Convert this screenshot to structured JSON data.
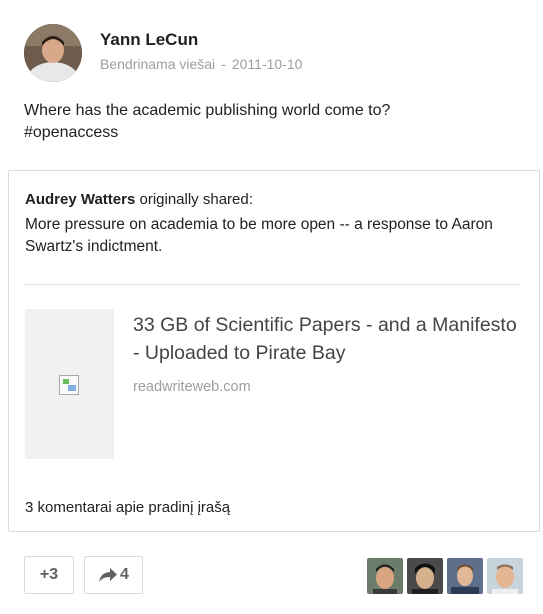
{
  "post": {
    "author": "Yann LeCun",
    "visibility": "Bendrinama viešai",
    "separator": "-",
    "date": "2011-10-10",
    "text": "Where has the academic publishing world come to?",
    "hashtag": "#openaccess"
  },
  "reshare": {
    "original_author": "Audrey Watters",
    "shared_suffix": "originally shared:",
    "text": "More pressure on academia to be more open -- a response to Aaron Swartz's indictment.",
    "link": {
      "title": "33 GB of Scientific Papers - and a Manifesto - Uploaded to Pirate Bay",
      "domain": "readwriteweb.com"
    },
    "comments_label": "3 komentarai apie pradinį įrašą"
  },
  "actions": {
    "plus_one_label": "+3",
    "share_count": "4",
    "share_icon": "share-arrow-icon"
  },
  "colors": {
    "text": "#212121",
    "meta": "#9e9e9e",
    "border": "#dcdcdc",
    "button_text": "#616161"
  }
}
